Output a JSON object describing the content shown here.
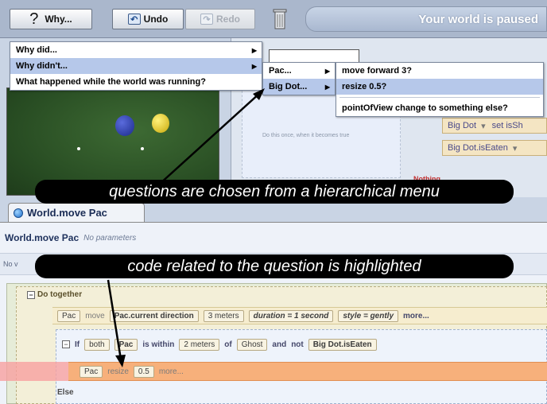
{
  "toolbar": {
    "why_label": "Why...",
    "undo_label": "Undo",
    "redo_label": "Redo",
    "status_text": "Your world is paused"
  },
  "why_menu": {
    "items": [
      "Why did...",
      "Why didn't...",
      "What happened while the world was running?"
    ]
  },
  "submenu_objects": {
    "items": [
      "Pac...",
      "Big Dot..."
    ]
  },
  "submenu_questions": {
    "items": [
      "move forward 3?",
      "resize 0.5?",
      "pointOfView change to something else?"
    ]
  },
  "code_behind": {
    "event_text": "Do this once, when it becomes true",
    "row1": "Big Dot",
    "row1_set": "set isSh",
    "row2": "Big Dot.isEaten",
    "nothing": "Nothing"
  },
  "editor": {
    "tab_label": "World.move Pac",
    "method_name": "World.move Pac",
    "params": "No parameters",
    "locals_prefix": "No v",
    "do_together": "Do together",
    "move_stmt": {
      "obj": "Pac",
      "verb": "move",
      "direction": "Pac.current direction",
      "amount": "3 meters",
      "duration": "duration = 1 second",
      "style": "style = gently",
      "more": "more..."
    },
    "if_stmt": {
      "keyword": "If",
      "both": "both",
      "obj": "Pac",
      "within": "is within",
      "dist": "2 meters",
      "of": "of",
      "target": "Ghost",
      "and": "and",
      "not": "not",
      "cond": "Big Dot.isEaten"
    },
    "resize_stmt": {
      "obj": "Pac",
      "verb": "resize",
      "value": "0.5",
      "more": "more..."
    },
    "else_label": "Else"
  },
  "annotations": {
    "menu_caption": "questions are chosen from a hierarchical menu",
    "code_caption": "code related to the question is highlighted"
  }
}
